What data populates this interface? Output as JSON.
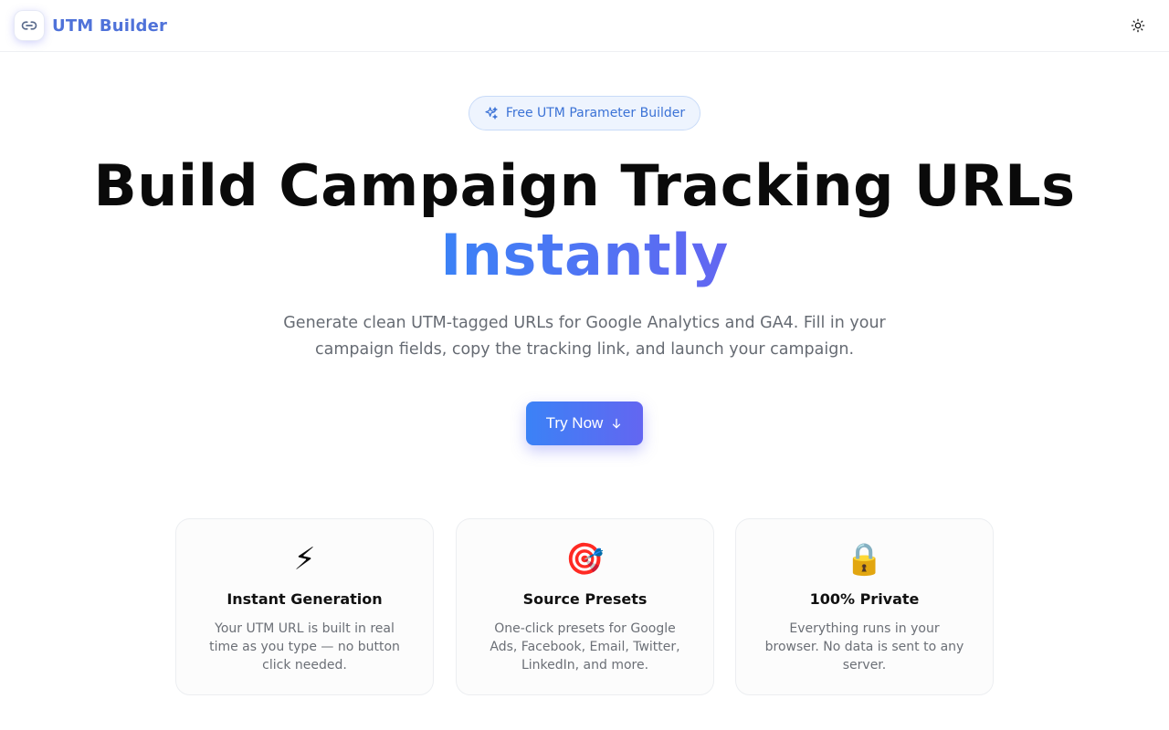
{
  "header": {
    "brand_name": "UTM Builder",
    "brand_icon": "link-icon",
    "theme_icon": "sun-icon"
  },
  "hero": {
    "badge_icon": "sparkles-icon",
    "badge_text": "Free UTM Parameter Builder",
    "title_line1": "Build Campaign Tracking URLs",
    "title_line2": "Instantly",
    "subtitle": "Generate clean UTM-tagged URLs for Google Analytics and GA4. Fill in your campaign fields, copy the tracking link, and launch your campaign.",
    "cta_label": "Try Now",
    "cta_icon": "arrow-down-icon"
  },
  "features": [
    {
      "icon": "⚡",
      "title": "Instant Generation",
      "desc": "Your UTM URL is built in real time as you type — no button click needed."
    },
    {
      "icon": "🎯",
      "title": "Source Presets",
      "desc": "One-click presets for Google Ads, Facebook, Email, Twitter, LinkedIn, and more."
    },
    {
      "icon": "🔒",
      "title": "100% Private",
      "desc": "Everything runs in your browser. No data is sent to any server."
    }
  ],
  "colors": {
    "brand": "#4f72d9",
    "gradient_start": "#3b82f6",
    "gradient_end": "#6366f1",
    "badge_bg": "#eef4fe"
  }
}
